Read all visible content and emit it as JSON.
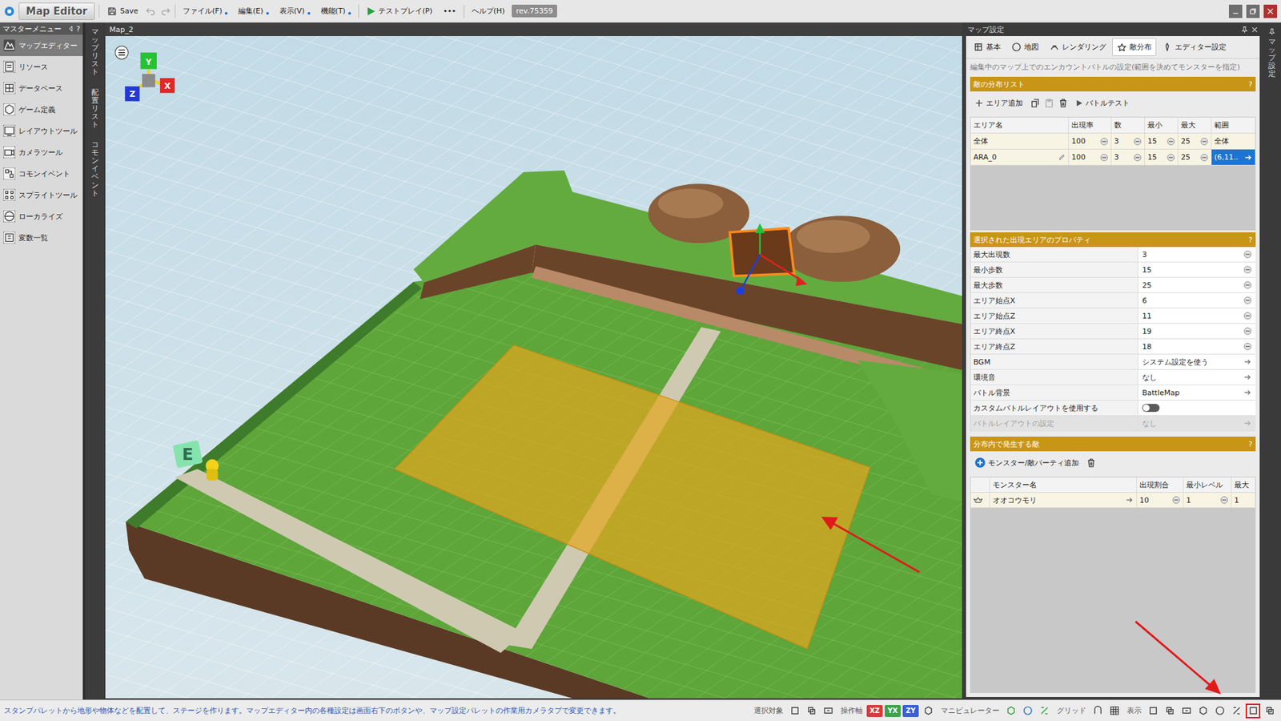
{
  "app": {
    "title": "Map Editor"
  },
  "toolbar": {
    "save": "Save",
    "menus": [
      {
        "label": "ファイル(F)"
      },
      {
        "label": "編集(E)"
      },
      {
        "label": "表示(V)"
      },
      {
        "label": "機能(T)"
      }
    ],
    "testplay": "テストプレイ(P)",
    "more": "•••",
    "help": "ヘルプ(H)",
    "revision": "rev.75359"
  },
  "master_menu": {
    "title": "マスターメニュー",
    "help": "?",
    "items": [
      {
        "label": "マップエディター",
        "selected": true
      },
      {
        "label": "リソース",
        "selected": false
      },
      {
        "label": "データベース",
        "selected": false
      },
      {
        "label": "ゲーム定義",
        "selected": false
      },
      {
        "label": "レイアウトツール",
        "selected": false
      },
      {
        "label": "カメラツール",
        "selected": false
      },
      {
        "label": "コモンイベント",
        "selected": false
      },
      {
        "label": "スプライトツール",
        "selected": false
      },
      {
        "label": "ローカライズ",
        "selected": false
      },
      {
        "label": "変数一覧",
        "selected": false
      }
    ]
  },
  "side_tabs": [
    {
      "label": "マップリスト"
    },
    {
      "label": "配置リスト"
    },
    {
      "label": "コモンイベント"
    }
  ],
  "viewport": {
    "title": "Map_2",
    "axes": {
      "x": "X",
      "y": "Y",
      "z": "Z"
    },
    "event_marker": "E"
  },
  "map_settings": {
    "title": "マップ設定",
    "side_label": "マップ設定",
    "tabs": [
      {
        "label": "基本",
        "selected": false
      },
      {
        "label": "地図",
        "selected": false
      },
      {
        "label": "レンダリング",
        "selected": false
      },
      {
        "label": "敵分布",
        "selected": true
      },
      {
        "label": "エディター設定",
        "selected": false
      }
    ],
    "description": "編集中のマップ上でのエンカウントバトルの設定(範囲を決めてモンスターを指定)",
    "area_list": {
      "title": "敵の分布リスト",
      "help": "?",
      "add_button": "エリア追加",
      "test_button": "バトルテスト",
      "columns": [
        "エリア名",
        "出現率",
        "数",
        "最小",
        "最大",
        "範囲"
      ],
      "rows": [
        {
          "name": "全体",
          "rate": "100",
          "count": "3",
          "min": "15",
          "max": "25",
          "range": "全体",
          "selected": false,
          "editable": false
        },
        {
          "name": "ARA_0",
          "rate": "100",
          "count": "3",
          "min": "15",
          "max": "25",
          "range": "(6,11..",
          "selected": true,
          "editable": true
        }
      ]
    },
    "properties": {
      "title": "選択された出現エリアのプロパティ",
      "help": "?",
      "rows": [
        {
          "label": "最大出現数",
          "value": "3",
          "kind": "number",
          "disabled": false
        },
        {
          "label": "最小歩数",
          "value": "15",
          "kind": "number",
          "disabled": false
        },
        {
          "label": "最大歩数",
          "value": "25",
          "kind": "number",
          "disabled": false
        },
        {
          "label": "エリア始点X",
          "value": "6",
          "kind": "number",
          "disabled": false
        },
        {
          "label": "エリア始点Z",
          "value": "11",
          "kind": "number",
          "disabled": false
        },
        {
          "label": "エリア終点X",
          "value": "19",
          "kind": "number",
          "disabled": false
        },
        {
          "label": "エリア終点Z",
          "value": "18",
          "kind": "number",
          "disabled": false
        },
        {
          "label": "BGM",
          "value": "システム設定を使う",
          "kind": "link",
          "disabled": false
        },
        {
          "label": "環境音",
          "value": "なし",
          "kind": "link",
          "disabled": false
        },
        {
          "label": "バトル背景",
          "value": "BattleMap",
          "kind": "link",
          "disabled": false
        },
        {
          "label": "カスタムバトルレイアウトを使用する",
          "value": "",
          "kind": "toggle",
          "on": false,
          "disabled": false
        },
        {
          "label": "バトルレイアウトの設定",
          "value": "なし",
          "kind": "link",
          "disabled": true
        }
      ]
    },
    "enemies": {
      "title": "分布内で発生する敵",
      "help": "?",
      "add_button": "モンスター/敵パーティ追加",
      "columns": [
        "モンスター名",
        "出現割合",
        "最小レベル",
        "最大"
      ],
      "rows": [
        {
          "name": "オオコウモリ",
          "rate": "10",
          "min_level": "1",
          "max_level": "1"
        }
      ]
    }
  },
  "status_bar": {
    "hint": "スタンプパレットから地形や物体などを配置して、ステージを作ります。マップエディター内の各種設定は画面右下のボタンや、マップ設定パレットの作業用カメラタブで変更できます。",
    "labels": {
      "target": "選択対象",
      "axis": "操作軸",
      "manipulator": "マニピュレーター",
      "grid": "グリッド",
      "display": "表示"
    },
    "axes": [
      {
        "label": "XZ",
        "color": "#d63b3b"
      },
      {
        "label": "YX",
        "color": "#3ca34c"
      },
      {
        "label": "ZY",
        "color": "#3b5fd6"
      }
    ],
    "display_buttons": [
      {
        "highlighted": false
      },
      {
        "highlighted": false
      },
      {
        "highlighted": false
      },
      {
        "highlighted": false
      },
      {
        "highlighted": false
      },
      {
        "highlighted": false
      },
      {
        "highlighted": true
      },
      {
        "highlighted": false
      }
    ]
  }
}
